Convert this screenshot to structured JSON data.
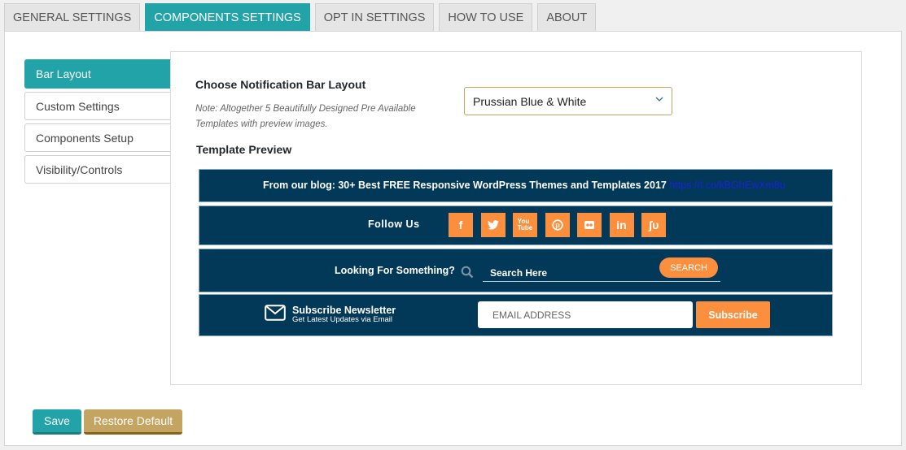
{
  "tabs": [
    {
      "label": "General Settings",
      "active": false
    },
    {
      "label": "Components Settings",
      "active": true
    },
    {
      "label": "Opt In Settings",
      "active": false
    },
    {
      "label": "How To Use",
      "active": false
    },
    {
      "label": "About",
      "active": false
    }
  ],
  "sidebar": {
    "items": [
      {
        "label": "Bar Layout",
        "active": true
      },
      {
        "label": "Custom Settings",
        "active": false
      },
      {
        "label": "Components Setup",
        "active": false
      },
      {
        "label": "Visibility/Controls",
        "active": false
      }
    ]
  },
  "layout_section": {
    "heading": "Choose Notification Bar Layout",
    "note": "Note: Altogether 5 Beautifully Designed Pre Available Templates with preview images.",
    "select": {
      "value": "Prussian Blue & White",
      "icon": "chevron-down-icon"
    },
    "preview_heading": "Template Preview"
  },
  "preview": {
    "bar_color": "#023858",
    "accent_color": "#fb8f3d",
    "blog": {
      "text": "From our blog: 30+ Best FREE Responsive WordPress Themes and Templates 2017",
      "link": "https://t.co/kBGhEwXm8u"
    },
    "follow": {
      "label": "Follow Us",
      "icons": [
        {
          "name": "facebook-icon",
          "glyph": "f"
        },
        {
          "name": "twitter-icon",
          "glyph": "🐦"
        },
        {
          "name": "youtube-icon",
          "glyph": "▶"
        },
        {
          "name": "pinterest-icon",
          "glyph": "℗"
        },
        {
          "name": "flickr-icon",
          "glyph": "●●"
        },
        {
          "name": "linkedin-icon",
          "glyph": "in"
        },
        {
          "name": "stumbleupon-icon",
          "glyph": "ʃυ"
        }
      ]
    },
    "search": {
      "label": "Looking For Something?",
      "placeholder": "Search Here",
      "button": "SEARCH"
    },
    "newsletter": {
      "title": "Subscribe Newsletter",
      "subtitle": "Get Latest Updates via Email",
      "email_placeholder": "EMAIL ADDRESS",
      "button": "Subscribe"
    }
  },
  "footer": {
    "save_label": "Save",
    "restore_label": "Restore Default"
  }
}
